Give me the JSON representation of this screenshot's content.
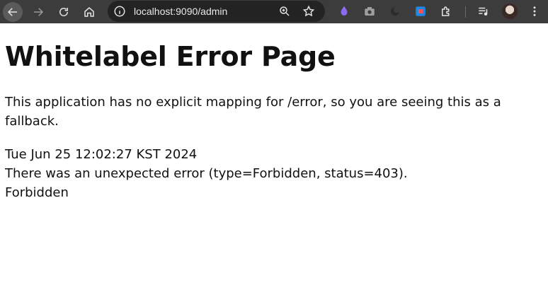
{
  "browser": {
    "url": "localhost:9090/admin",
    "icons": {
      "back": "back-arrow-icon",
      "forward": "forward-arrow-icon",
      "reload": "reload-icon",
      "home": "home-icon",
      "site_info": "info-icon",
      "zoom": "zoom-icon",
      "bookmark": "star-icon",
      "extensions": [
        "droplet-icon",
        "camera-icon",
        "moon-icon",
        "square-icon",
        "puzzle-icon"
      ],
      "media": "media-queue-icon",
      "profile": "avatar",
      "menu": "kebab-menu-icon"
    },
    "colors": {
      "toolbar": "#3c3c3c",
      "omnibox": "#232323",
      "drop_extension": "#8b6cf0",
      "square_extension": "#1e88e5"
    }
  },
  "page": {
    "title": "Whitelabel Error Page",
    "description": "This application has no explicit mapping for /error, so you are seeing this as a fallback.",
    "timestamp": "Tue Jun 25 12:02:27 KST 2024",
    "error_message": "There was an unexpected error (type=Forbidden, status=403).",
    "error_detail": "Forbidden"
  }
}
